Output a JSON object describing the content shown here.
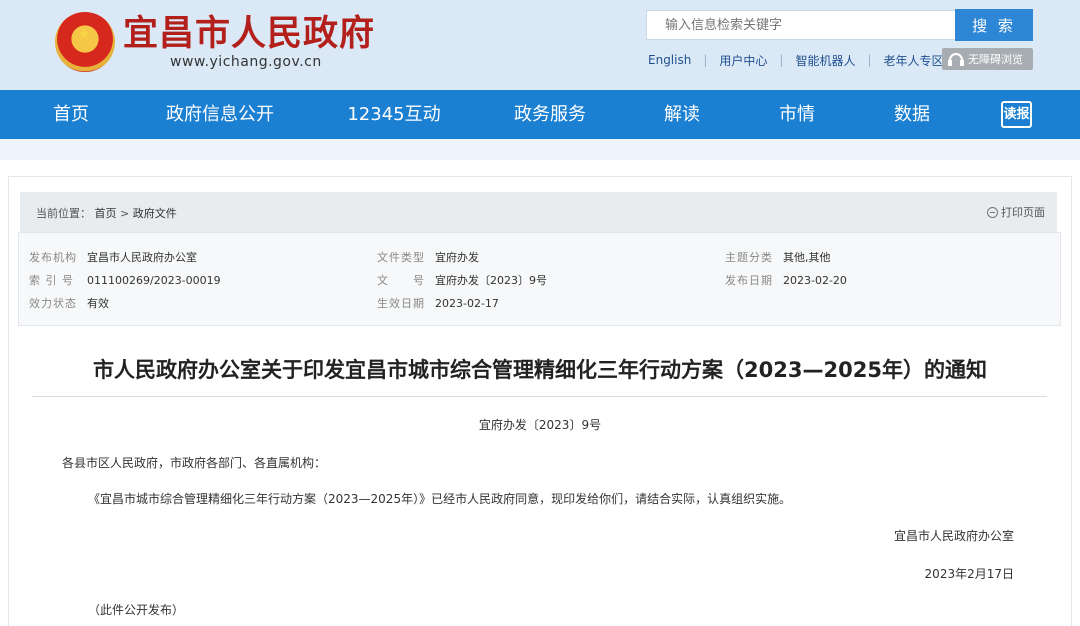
{
  "header": {
    "site_title": "宜昌市人民政府",
    "site_url": "www.yichang.gov.cn",
    "search_placeholder": "输入信息检索关键字",
    "search_button": "搜 索",
    "links": [
      "English",
      "用户中心",
      "智能机器人",
      "老年人专区"
    ],
    "accessibility": "无障碍浏览"
  },
  "nav": {
    "items": [
      "首页",
      "政府信息公开",
      "12345互动",
      "政务服务",
      "解读",
      "市情",
      "数据"
    ],
    "readbao": "读报"
  },
  "breadcrumb": {
    "label": "当前位置：",
    "home": "首页",
    "sep": ">",
    "current": "政府文件",
    "print": "打印页面"
  },
  "meta": {
    "publisher_label": "发布机构",
    "publisher": "宜昌市人民政府办公室",
    "doc_type_label": "文件类型",
    "doc_type": "宜府办发",
    "category_label": "主题分类",
    "category": "其他,其他",
    "index_label": "索 引 号",
    "index": "011100269/2023-00019",
    "doc_no_label": "文　　号",
    "doc_no": "宜府办发〔2023〕9号",
    "pub_date_label": "发布日期",
    "pub_date": "2023-02-20",
    "status_label": "效力状态",
    "status": "有效",
    "effective_label": "生效日期",
    "effective": "2023-02-17"
  },
  "document": {
    "title": "市人民政府办公室关于印发宜昌市城市综合管理精细化三年行动方案（2023—2025年）的通知",
    "doc_no": "宜府办发〔2023〕9号",
    "salutation": "各县市区人民政府，市政府各部门、各直属机构：",
    "body": "《宜昌市城市综合管理精细化三年行动方案（2023—2025年）》已经市人民政府同意，现印发给你们，请结合实际，认真组织实施。",
    "signature": "宜昌市人民政府办公室",
    "date": "2023年2月17日",
    "note": "（此件公开发布）"
  }
}
